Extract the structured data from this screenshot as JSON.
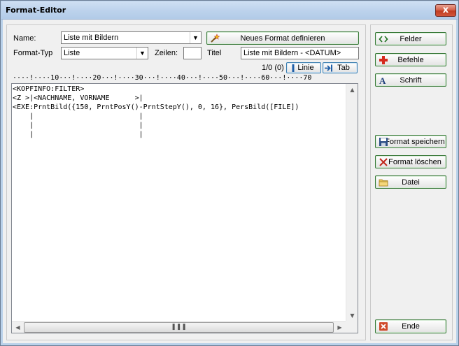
{
  "window": {
    "title": "Format-Editor",
    "close_glyph": "x"
  },
  "form": {
    "name_label": "Name:",
    "name_value": "Liste mit Bildern",
    "type_label": "Format-Typ",
    "type_value": "Liste",
    "rows_label": "Zeilen:",
    "rows_value": "",
    "title_label": "Titel",
    "title_value": "Liste mit Bildern - <DATUM>",
    "new_format_label": "Neues Format definieren",
    "position_text": "1/0 (0)",
    "line_label": "Linie",
    "tab_label": "Tab"
  },
  "ruler": {
    "text": "····!····10···!····20···!····30···!····40···!····50···!····60···!····70"
  },
  "editor": {
    "content": "<KOPFINFO:FILTER>\n<Z >|<NACHNAME, VORNAME      >|\n<EXE:PrntBild({150, PrntPosY()-PrntStepY(), 0, 16}, PersBild([FILE])\n    |                         |\n    |                         |\n    |                         |"
  },
  "sidebar": {
    "fields_label": "Felder",
    "commands_label": "Befehle",
    "font_label": "Schrift",
    "save_label": "Format speichern",
    "delete_label": "Format löschen",
    "file_label": "Datei",
    "end_label": "Ende"
  },
  "colors": {
    "accent_green": "#3a7a3a",
    "close_red": "#c13d22",
    "titlebar": "#bcd2ec"
  }
}
